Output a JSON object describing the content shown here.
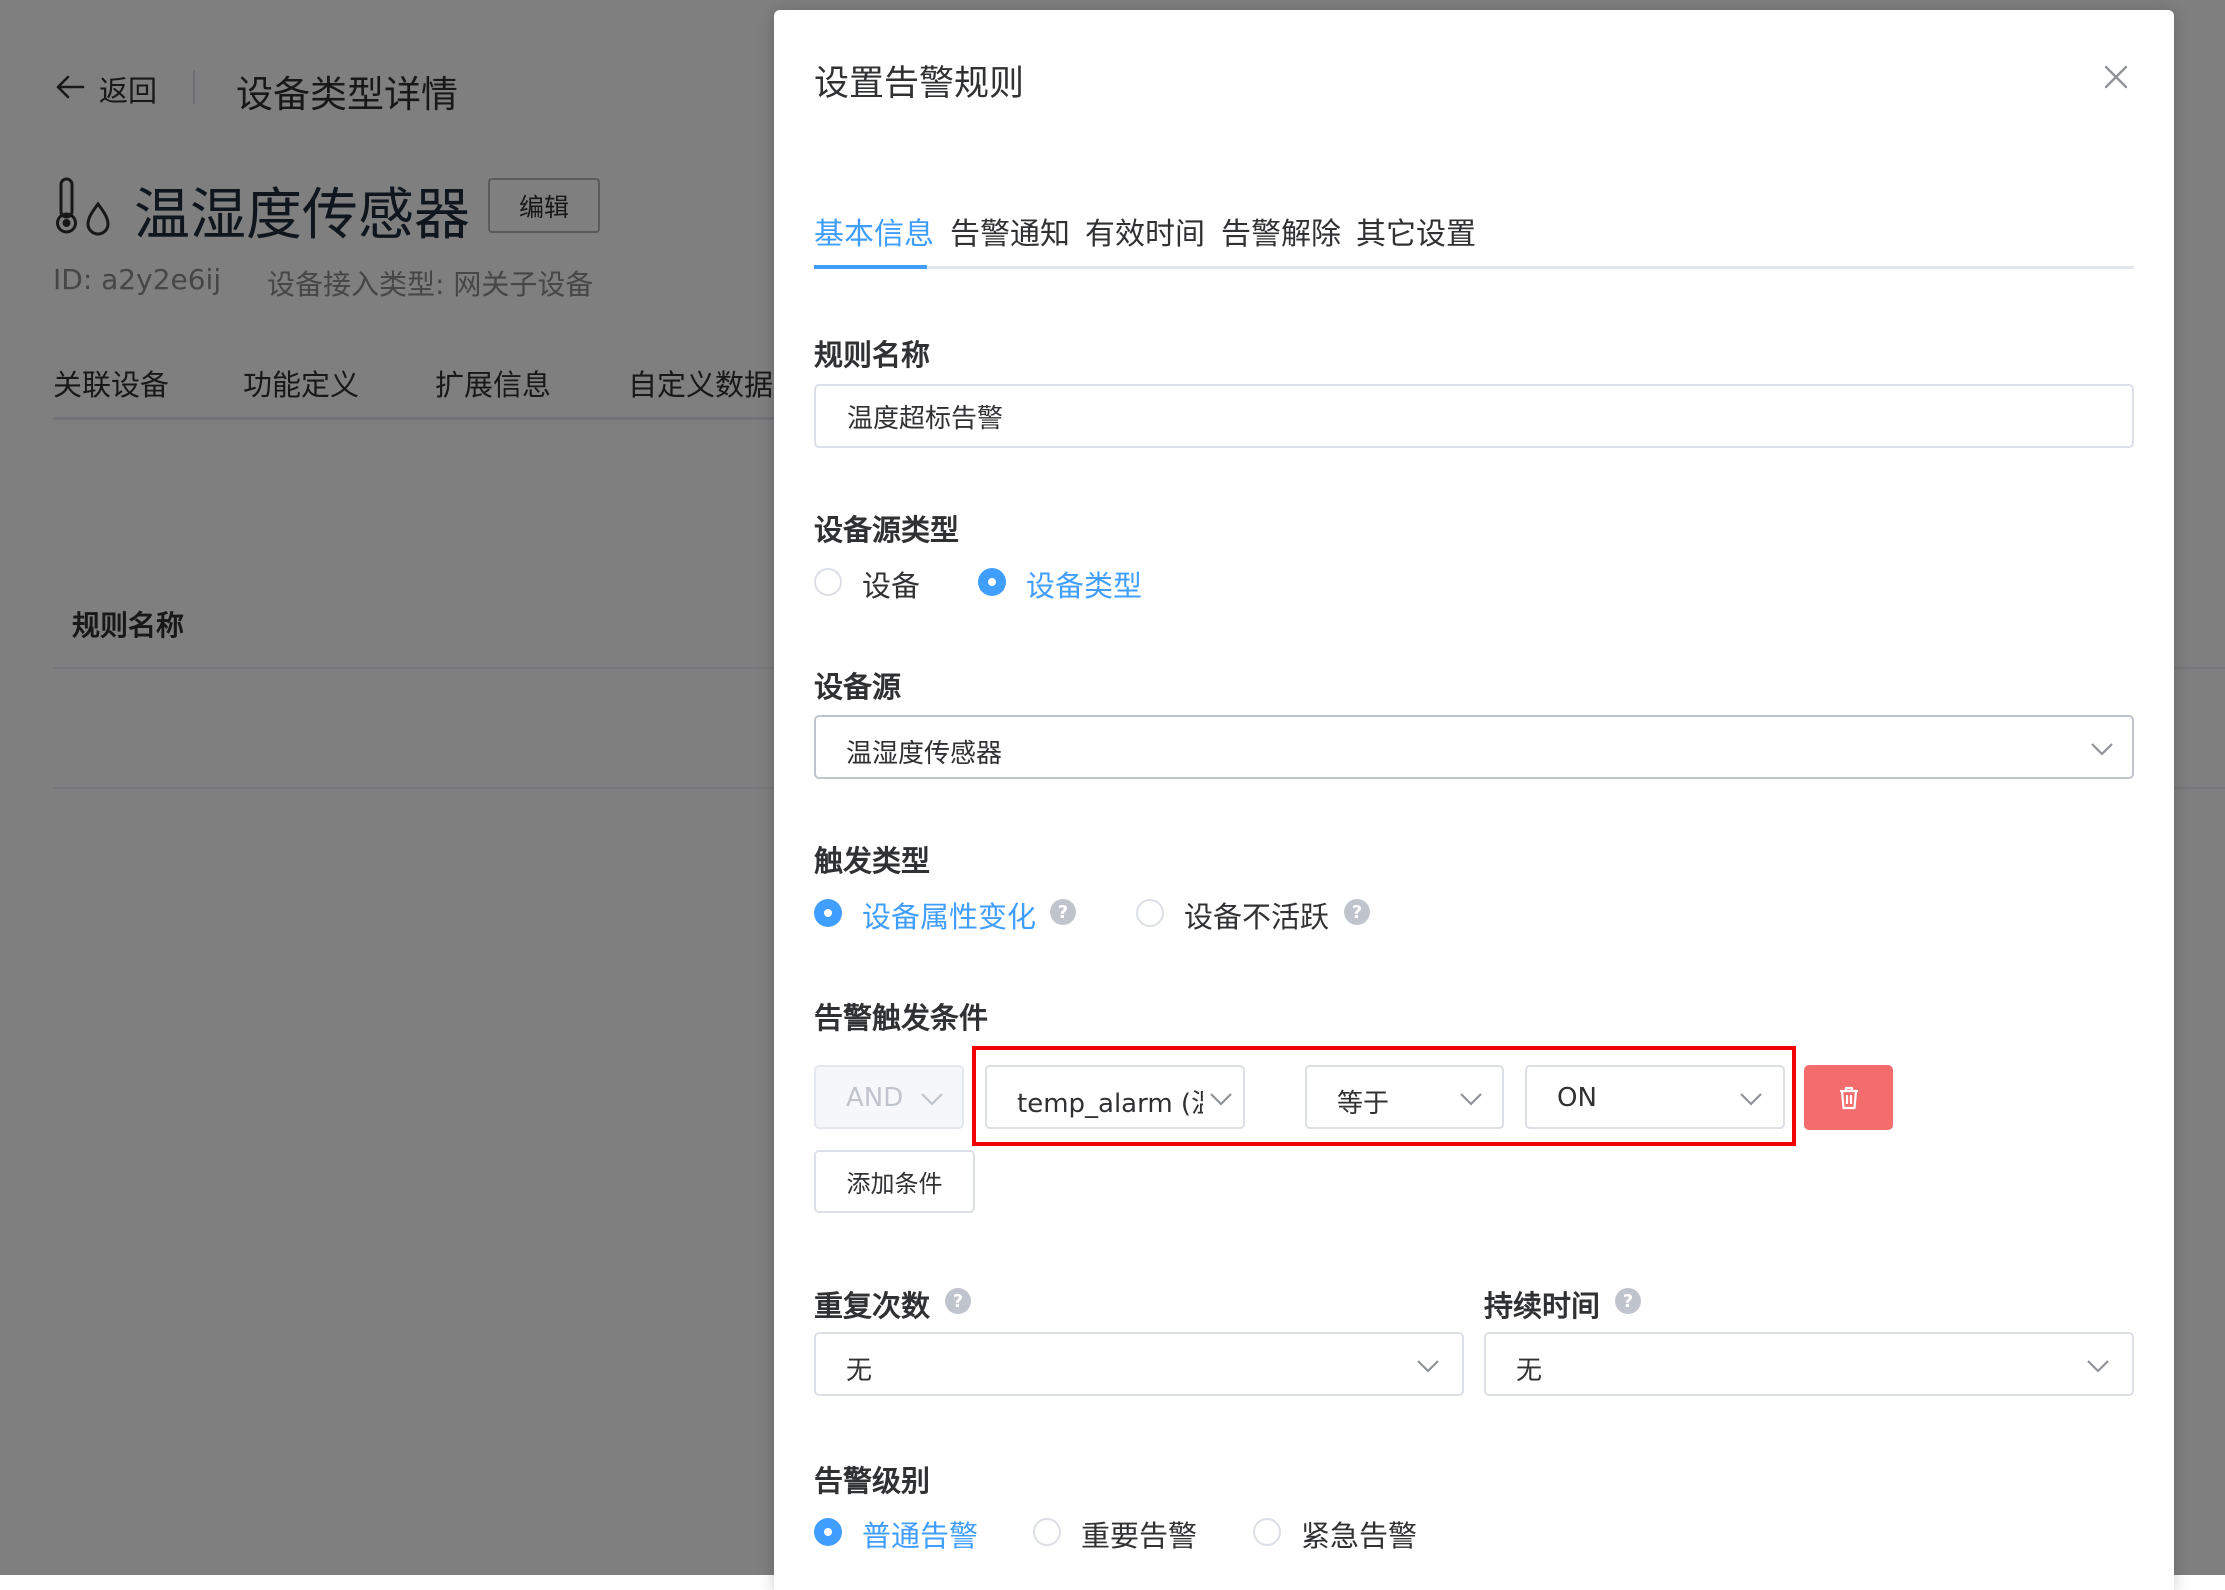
{
  "background_page": {
    "back_label": "返回",
    "title": "设备类型详情",
    "device_name": "温湿度传感器",
    "edit_label": "编辑",
    "id_text": "ID: a2y2e6ij",
    "access_type_text": "设备接入类型: 网关子设备",
    "tabs": [
      "关联设备",
      "功能定义",
      "扩展信息",
      "自定义数据源"
    ],
    "table_header": "规则名称"
  },
  "dialog": {
    "title": "设置告警规则",
    "tabs": [
      "基本信息",
      "告警通知",
      "有效时间",
      "告警解除",
      "其它设置"
    ],
    "active_tab": "基本信息",
    "rule_name": {
      "label": "规则名称",
      "value": "温度超标告警"
    },
    "source_type": {
      "label": "设备源类型",
      "options": [
        "设备",
        "设备类型"
      ],
      "selected": "设备类型"
    },
    "source": {
      "label": "设备源",
      "value": "温湿度传感器"
    },
    "trigger_type": {
      "label": "触发类型",
      "options": [
        "设备属性变化",
        "设备不活跃"
      ],
      "selected": "设备属性变化"
    },
    "condition": {
      "label": "告警触发条件",
      "logic": "AND",
      "property": "temp_alarm (温度告",
      "operator": "等于",
      "value": "ON",
      "add_label": "添加条件"
    },
    "repeat": {
      "label": "重复次数",
      "value": "无"
    },
    "duration": {
      "label": "持续时间",
      "value": "无"
    },
    "level": {
      "label": "告警级别",
      "options": [
        "普通告警",
        "重要告警",
        "紧急告警"
      ],
      "selected": "普通告警"
    },
    "help_glyph": "?"
  },
  "colors": {
    "primary": "#409eff",
    "danger": "#f56c6c",
    "highlight": "#f00000"
  },
  "icons": [
    "arrow-left-icon",
    "thermometer-drop-icon",
    "close-icon",
    "chevron-down-icon",
    "help-circle-icon",
    "trash-icon"
  ]
}
